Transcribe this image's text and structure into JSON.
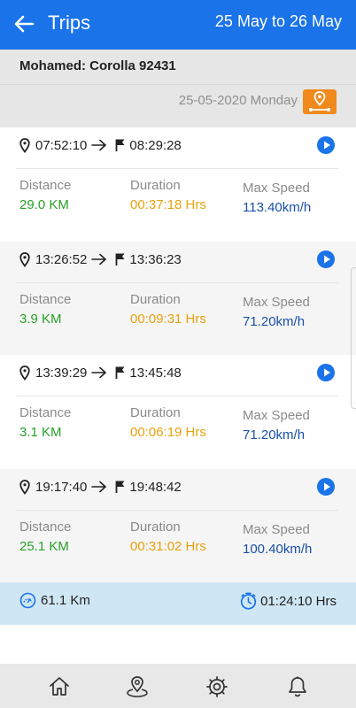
{
  "header": {
    "title": "Trips",
    "date_range": "25 May to 26 May"
  },
  "vehicle": {
    "label": "Mohamed: Corolla 92431"
  },
  "day": {
    "date_label": "25-05-2020 Monday"
  },
  "stat_labels": {
    "distance": "Distance",
    "duration": "Duration",
    "max_speed": "Max Speed"
  },
  "trips": [
    {
      "start": "07:52:10",
      "end": "08:29:28",
      "distance": "29.0 KM",
      "duration": "00:37:18 Hrs",
      "max_speed": "113.40km/h"
    },
    {
      "start": "13:26:52",
      "end": "13:36:23",
      "distance": "3.9 KM",
      "duration": "00:09:31 Hrs",
      "max_speed": "71.20km/h"
    },
    {
      "start": "13:39:29",
      "end": "13:45:48",
      "distance": "3.1 KM",
      "duration": "00:06:19 Hrs",
      "max_speed": "71.20km/h"
    },
    {
      "start": "19:17:40",
      "end": "19:48:42",
      "distance": "25.1 KM",
      "duration": "00:31:02 Hrs",
      "max_speed": "100.40km/h"
    }
  ],
  "summary": {
    "total_distance": "61.1 Km",
    "total_duration": "01:24:10 Hrs"
  },
  "icons": {
    "back": "arrow-left-icon",
    "route": "route-icon",
    "start": "location-pin-icon",
    "arrow": "arrow-right-icon",
    "end": "flag-icon",
    "play": "play-circle-icon",
    "odometer": "speedometer-icon",
    "timer": "stopwatch-icon",
    "nav": [
      "home-icon",
      "map-pin-icon",
      "gear-icon",
      "bell-icon"
    ]
  },
  "colors": {
    "primary": "#1a73e8",
    "distance": "#28a028",
    "duration": "#e8a10c",
    "speed": "#1a4fa8",
    "route_button": "#f08a1c",
    "summary_bg": "#cfe6f4"
  }
}
